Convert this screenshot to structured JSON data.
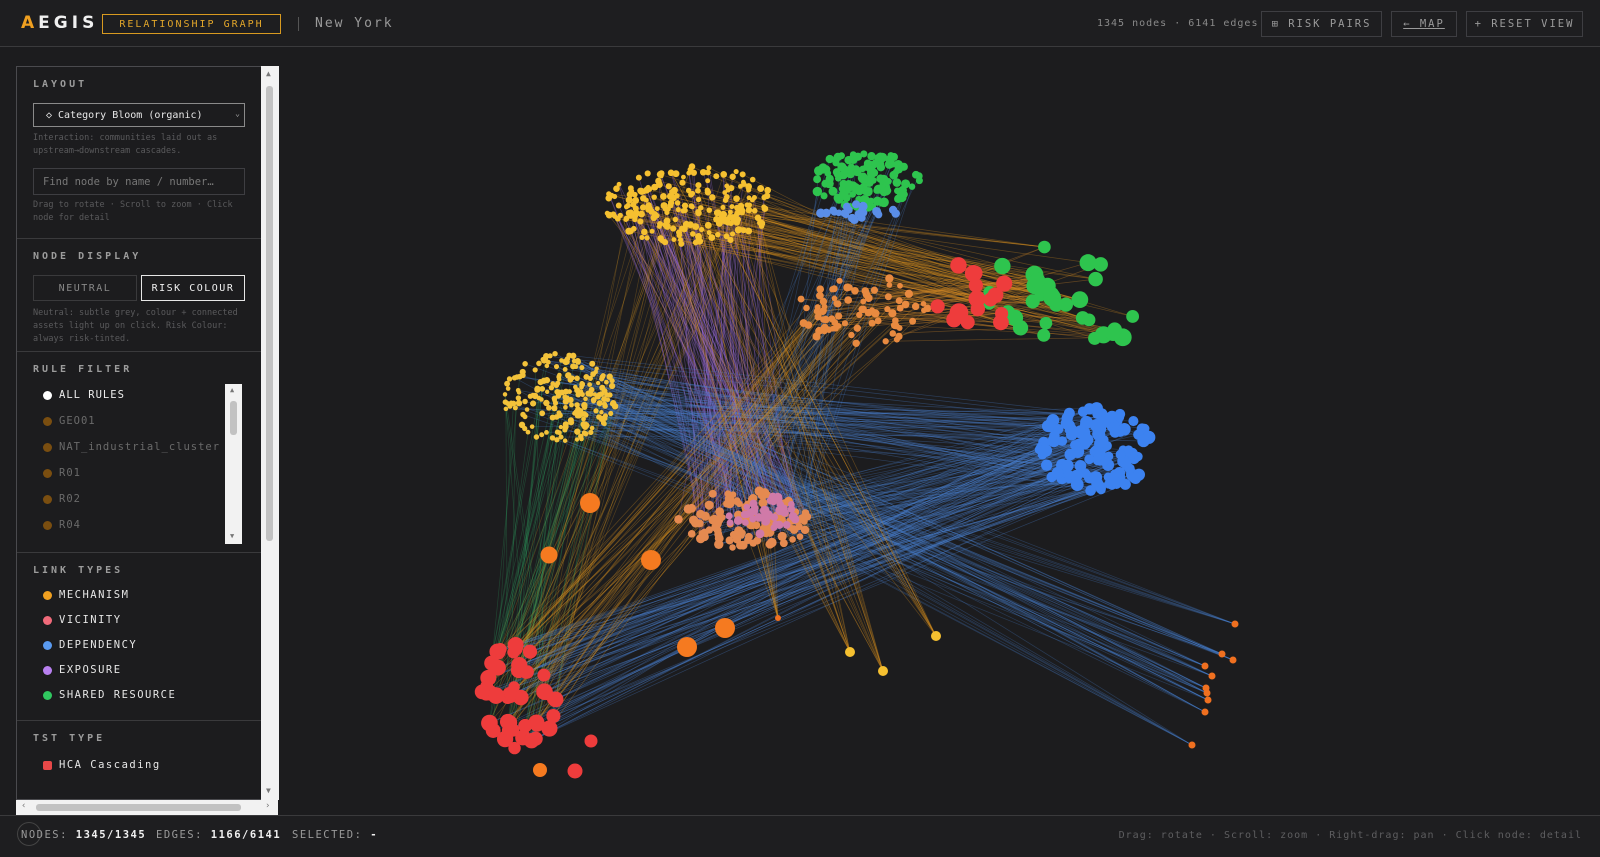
{
  "header": {
    "logo_first": "A",
    "logo_rest": "EGIS",
    "mode": "RELATIONSHIP GRAPH",
    "city": "New York",
    "stats": "1345 nodes · 6141 edges",
    "risk_pairs": "⊞ RISK PAIRS",
    "map": "← MAP",
    "reset": "+ RESET VIEW"
  },
  "panel": {
    "layout_title": "LAYOUT",
    "layout_value": "◇ Category Bloom (organic)",
    "layout_hint": "Interaction: communities laid out as upstream→downstream cascades.",
    "search_placeholder": "Find node by name / number…",
    "search_hint": "Drag to rotate · Scroll to zoom · Click node for detail",
    "display_title": "NODE DISPLAY",
    "neutral_label": "NEUTRAL",
    "risk_label": "RISK COLOUR",
    "display_hint": "Neutral: subtle grey, colour + connected assets light up on click. Risk Colour: always risk-tinted.",
    "rule_title": "RULE FILTER",
    "rules": [
      {
        "label": "ALL RULES",
        "color": "#ffffff"
      },
      {
        "label": "GEO01",
        "color": "#7a4e10"
      },
      {
        "label": "NAT_industrial_cluster",
        "color": "#7a4e10"
      },
      {
        "label": "R01",
        "color": "#7a4e10"
      },
      {
        "label": "R02",
        "color": "#7a4e10"
      },
      {
        "label": "R04",
        "color": "#7a4e10"
      }
    ],
    "link_title": "LINK TYPES",
    "links": [
      {
        "label": "MECHANISM",
        "color": "#f0a020"
      },
      {
        "label": "VICINITY",
        "color": "#f06a7a"
      },
      {
        "label": "DEPENDENCY",
        "color": "#5a9af0"
      },
      {
        "label": "EXPOSURE",
        "color": "#b880f0"
      },
      {
        "label": "SHARED RESOURCE",
        "color": "#30c860"
      }
    ],
    "tst_title": "TST TYPE",
    "tst_item": {
      "label": "HCA Cascading",
      "color": "#e84848"
    }
  },
  "status": {
    "nodes_label": "NODES:",
    "nodes_value": "1345/1345",
    "edges_label": "EDGES:",
    "edges_value": "1166/6141",
    "selected_label": "SELECTED:",
    "selected_value": "-",
    "hint": "Drag: rotate · Scroll: zoom · Right-drag: pan · Click node: detail"
  }
}
